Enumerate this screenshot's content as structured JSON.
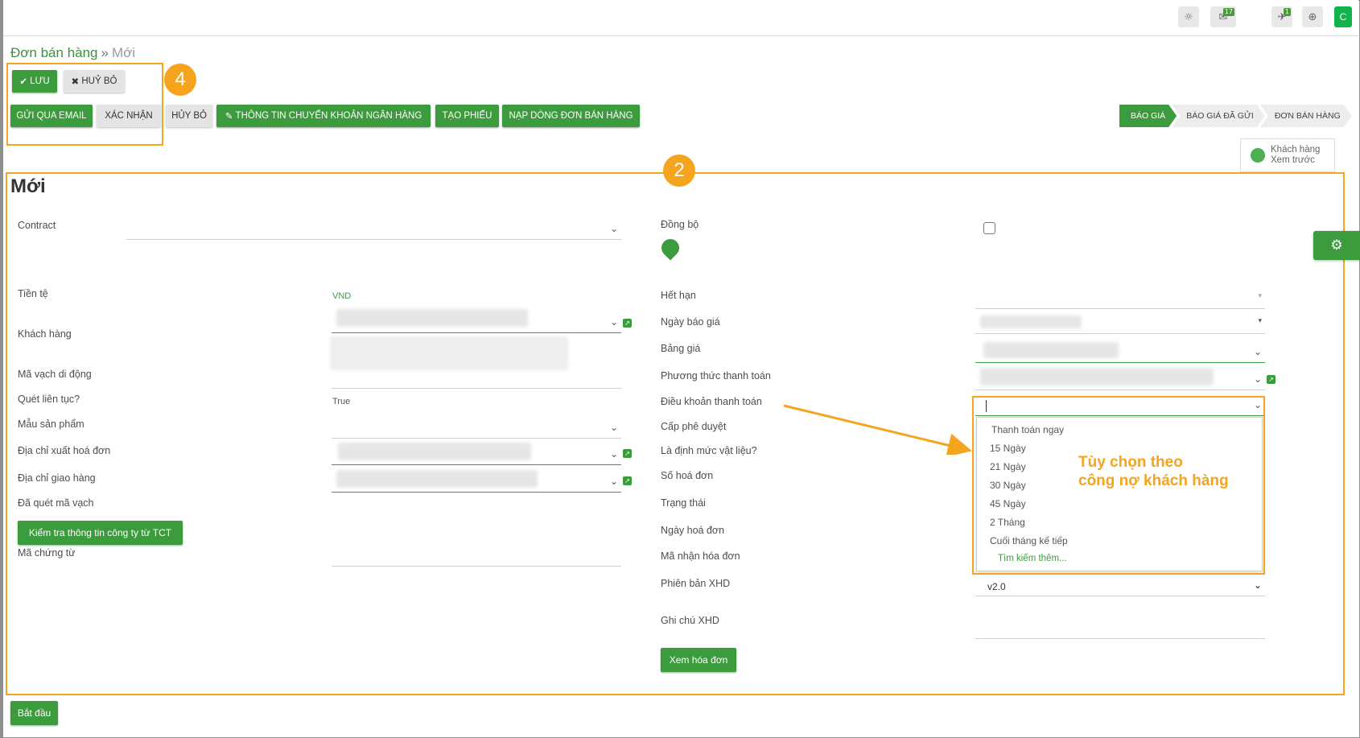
{
  "topbar": {
    "icons": [
      {
        "name": "bug-icon",
        "glyph": "☼"
      },
      {
        "name": "chat-icon",
        "glyph": "✉",
        "count": "17"
      },
      {
        "name": "notification-icon",
        "glyph": "✈",
        "count": "1"
      },
      {
        "name": "globe-icon",
        "glyph": "⊕"
      }
    ],
    "avatar_letter": "C"
  },
  "breadcrumb": {
    "parent": "Đơn bán hàng",
    "separator": "»",
    "current": "Mới"
  },
  "actions": {
    "save": "LƯU",
    "discard": "HUỶ BỎ"
  },
  "toolbar": {
    "send_email": "GỬI QUA EMAIL",
    "confirm": "XÁC NHẬN",
    "cancel": "HỦY BỎ",
    "bank_info": "THÔNG TIN CHUYỂN KHOẢN NGÂN HÀNG",
    "create_ticket": "TẠO PHIẾU",
    "import_lines": "NẠP DÒNG ĐƠN BÁN HÀNG"
  },
  "status_steps": [
    "BÁO GIÁ",
    "BÁO GIÁ ĐÃ GỬI",
    "ĐƠN BÁN HÀNG"
  ],
  "preview": {
    "line1": "Khách hàng",
    "line2": "Xem trước"
  },
  "annotations": {
    "box4": "4",
    "box2": "2",
    "note_line1": "Tùy chọn theo",
    "note_line2": "công nợ khách hàng"
  },
  "form": {
    "title": "Mới",
    "left": {
      "contract": "Contract",
      "currency": "Tiền tệ",
      "currency_value": "VND",
      "customer": "Khách hàng",
      "mobile_barcode": "Mã vạch di động",
      "continuous_scan": "Quét liên tục?",
      "continuous_scan_value": "True",
      "product_template": "Mẫu sản phẩm",
      "invoice_address": "Địa chỉ xuất hoá đơn",
      "delivery_address": "Địa chỉ giao hàng",
      "scanned_barcode": "Đã quét mã vạch",
      "check_tct_button": "Kiểm tra thông tin công ty từ TCT",
      "voucher_code": "Mã chứng từ"
    },
    "right": {
      "sync": "Đồng bộ",
      "expiry": "Hết hạn",
      "quote_date": "Ngày báo giá",
      "pricelist": "Bảng giá",
      "payment_method": "Phương thức thanh toán",
      "payment_terms": "Điều khoản thanh toán",
      "approval_level": "Cấp phê duyệt",
      "material_norm": "Là định mức vật liệu?",
      "invoice_number": "Số hoá đơn",
      "state": "Trạng thái",
      "invoice_date": "Ngày hoá đơn",
      "invoice_receipt_code": "Mã nhận hóa đơn",
      "xhd_version": "Phiên bản XHD",
      "xhd_version_value": "v2.0",
      "xhd_note": "Ghi chú XHD",
      "view_invoice_button": "Xem hóa đơn"
    },
    "payment_terms_options": [
      "Thanh toán ngay",
      "15 Ngày",
      "21 Ngày",
      "30 Ngày",
      "45 Ngày",
      "2 Tháng",
      "Cuối tháng kế tiếp"
    ],
    "payment_terms_more": "Tìm kiếm thêm..."
  },
  "footer": {
    "start_button": "Bắt đầu"
  },
  "colors": {
    "accent": "#3c9b3c",
    "annotation": "#f4a41d"
  }
}
